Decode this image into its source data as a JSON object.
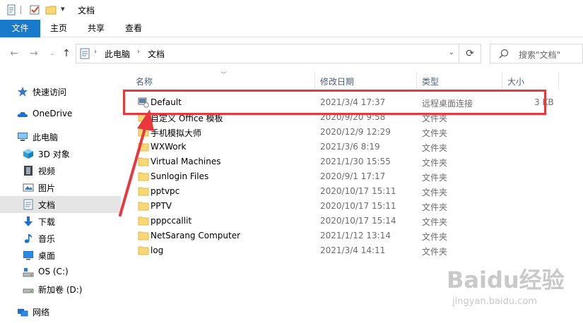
{
  "window": {
    "title": "文档",
    "quick_access_dropdown": "▾"
  },
  "ribbon": {
    "tabs": [
      "文件",
      "主页",
      "共享",
      "查看"
    ]
  },
  "address": {
    "crumbs": [
      "此电脑",
      "文档"
    ],
    "search_placeholder": "搜索\"文档\""
  },
  "sidebar": {
    "items": [
      {
        "label": "快速访问",
        "icon": "star-icon"
      },
      {
        "label": "OneDrive",
        "icon": "cloud-icon"
      },
      {
        "label": "此电脑",
        "icon": "computer-icon"
      },
      {
        "label": "3D 对象",
        "icon": "cube-icon"
      },
      {
        "label": "视频",
        "icon": "film-icon"
      },
      {
        "label": "图片",
        "icon": "picture-icon"
      },
      {
        "label": "文档",
        "icon": "document-icon",
        "selected": true
      },
      {
        "label": "下载",
        "icon": "download-icon"
      },
      {
        "label": "音乐",
        "icon": "music-icon"
      },
      {
        "label": "桌面",
        "icon": "desktop-icon"
      },
      {
        "label": "OS (C:)",
        "icon": "drive-icon"
      },
      {
        "label": "新加卷 (D:)",
        "icon": "drive-icon"
      },
      {
        "label": "网络",
        "icon": "network-icon"
      }
    ]
  },
  "columns": {
    "name": "名称",
    "modified": "修改日期",
    "type": "类型",
    "size": "大小"
  },
  "files": [
    {
      "name": "Default",
      "modified": "2021/3/4 17:37",
      "type": "远程桌面连接",
      "size": "3 KB",
      "icon": "rdp-file-icon"
    },
    {
      "name": "自定义 Office 模板",
      "modified": "2020/9/20 9:58",
      "type": "文件夹",
      "size": "",
      "icon": "folder-icon"
    },
    {
      "name": "手机模拟大师",
      "modified": "2020/12/9 12:29",
      "type": "文件夹",
      "size": "",
      "icon": "folder-icon"
    },
    {
      "name": "WXWork",
      "modified": "2021/3/6 8:19",
      "type": "文件夹",
      "size": "",
      "icon": "folder-icon"
    },
    {
      "name": "Virtual Machines",
      "modified": "2021/1/30 15:55",
      "type": "文件夹",
      "size": "",
      "icon": "folder-icon"
    },
    {
      "name": "Sunlogin Files",
      "modified": "2020/9/1 17:17",
      "type": "文件夹",
      "size": "",
      "icon": "folder-icon"
    },
    {
      "name": "pptvpc",
      "modified": "2020/10/17 15:11",
      "type": "文件夹",
      "size": "",
      "icon": "folder-icon"
    },
    {
      "name": "PPTV",
      "modified": "2020/10/17 15:11",
      "type": "文件夹",
      "size": "",
      "icon": "folder-icon"
    },
    {
      "name": "pppccallit",
      "modified": "2020/10/17 15:14",
      "type": "文件夹",
      "size": "",
      "icon": "folder-icon"
    },
    {
      "name": "NetSarang Computer",
      "modified": "2021/1/12 13:14",
      "type": "文件夹",
      "size": "",
      "icon": "folder-icon"
    },
    {
      "name": "log",
      "modified": "2021/3/4 14:11",
      "type": "文件夹",
      "size": "",
      "icon": "folder-icon"
    }
  ],
  "colors": {
    "file_tab": "#1979ca",
    "highlight": "#e8383d",
    "folder": "#f8d775",
    "selection": "#e5e5e5"
  },
  "watermark": {
    "logo": "Baidu经验",
    "url": "jingyan.baidu.com"
  }
}
